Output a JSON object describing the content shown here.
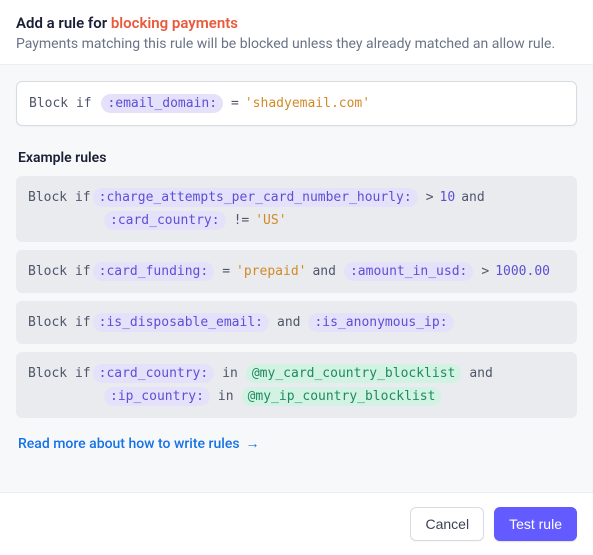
{
  "header": {
    "title_prefix": "Add a rule for ",
    "title_accent": "blocking payments",
    "subtitle": "Payments matching this rule will be blocked unless they already matched an allow rule."
  },
  "rule_input": {
    "keyword": "Block if",
    "tokens": [
      {
        "type": "var",
        "text": ":email_domain:"
      },
      {
        "type": "op",
        "text": "="
      },
      {
        "type": "str",
        "text": "'shadyemail.com'"
      }
    ]
  },
  "examples": {
    "title": "Example rules",
    "list": [
      {
        "lines": [
          [
            {
              "type": "kw",
              "text": "Block if"
            },
            {
              "type": "var",
              "text": ":charge_attempts_per_card_number_hourly:"
            },
            {
              "type": "op",
              "text": ">"
            },
            {
              "type": "num",
              "text": "10"
            },
            {
              "type": "op",
              "text": "and"
            }
          ],
          [
            {
              "type": "indent"
            },
            {
              "type": "var",
              "text": ":card_country:"
            },
            {
              "type": "op",
              "text": "!="
            },
            {
              "type": "str",
              "text": "'US'"
            }
          ]
        ]
      },
      {
        "lines": [
          [
            {
              "type": "kw",
              "text": "Block if"
            },
            {
              "type": "var",
              "text": ":card_funding:"
            },
            {
              "type": "op",
              "text": "="
            },
            {
              "type": "str",
              "text": "'prepaid'"
            },
            {
              "type": "op",
              "text": "and"
            },
            {
              "type": "var",
              "text": ":amount_in_usd:"
            },
            {
              "type": "op",
              "text": ">"
            },
            {
              "type": "num",
              "text": "1000.00"
            }
          ]
        ]
      },
      {
        "lines": [
          [
            {
              "type": "kw",
              "text": "Block if"
            },
            {
              "type": "var",
              "text": ":is_disposable_email:"
            },
            {
              "type": "op",
              "text": "and"
            },
            {
              "type": "var",
              "text": ":is_anonymous_ip:"
            }
          ]
        ]
      },
      {
        "lines": [
          [
            {
              "type": "kw",
              "text": "Block if"
            },
            {
              "type": "var",
              "text": ":card_country:"
            },
            {
              "type": "op-in",
              "text": "in"
            },
            {
              "type": "list",
              "text": "@my_card_country_blocklist"
            },
            {
              "type": "op",
              "text": "and"
            }
          ],
          [
            {
              "type": "indent"
            },
            {
              "type": "var",
              "text": ":ip_country:"
            },
            {
              "type": "op-in",
              "text": "in"
            },
            {
              "type": "list",
              "text": "@my_ip_country_blocklist"
            }
          ]
        ]
      }
    ]
  },
  "link": {
    "label": "Read more about how to write rules"
  },
  "footer": {
    "cancel": "Cancel",
    "test": "Test rule"
  }
}
